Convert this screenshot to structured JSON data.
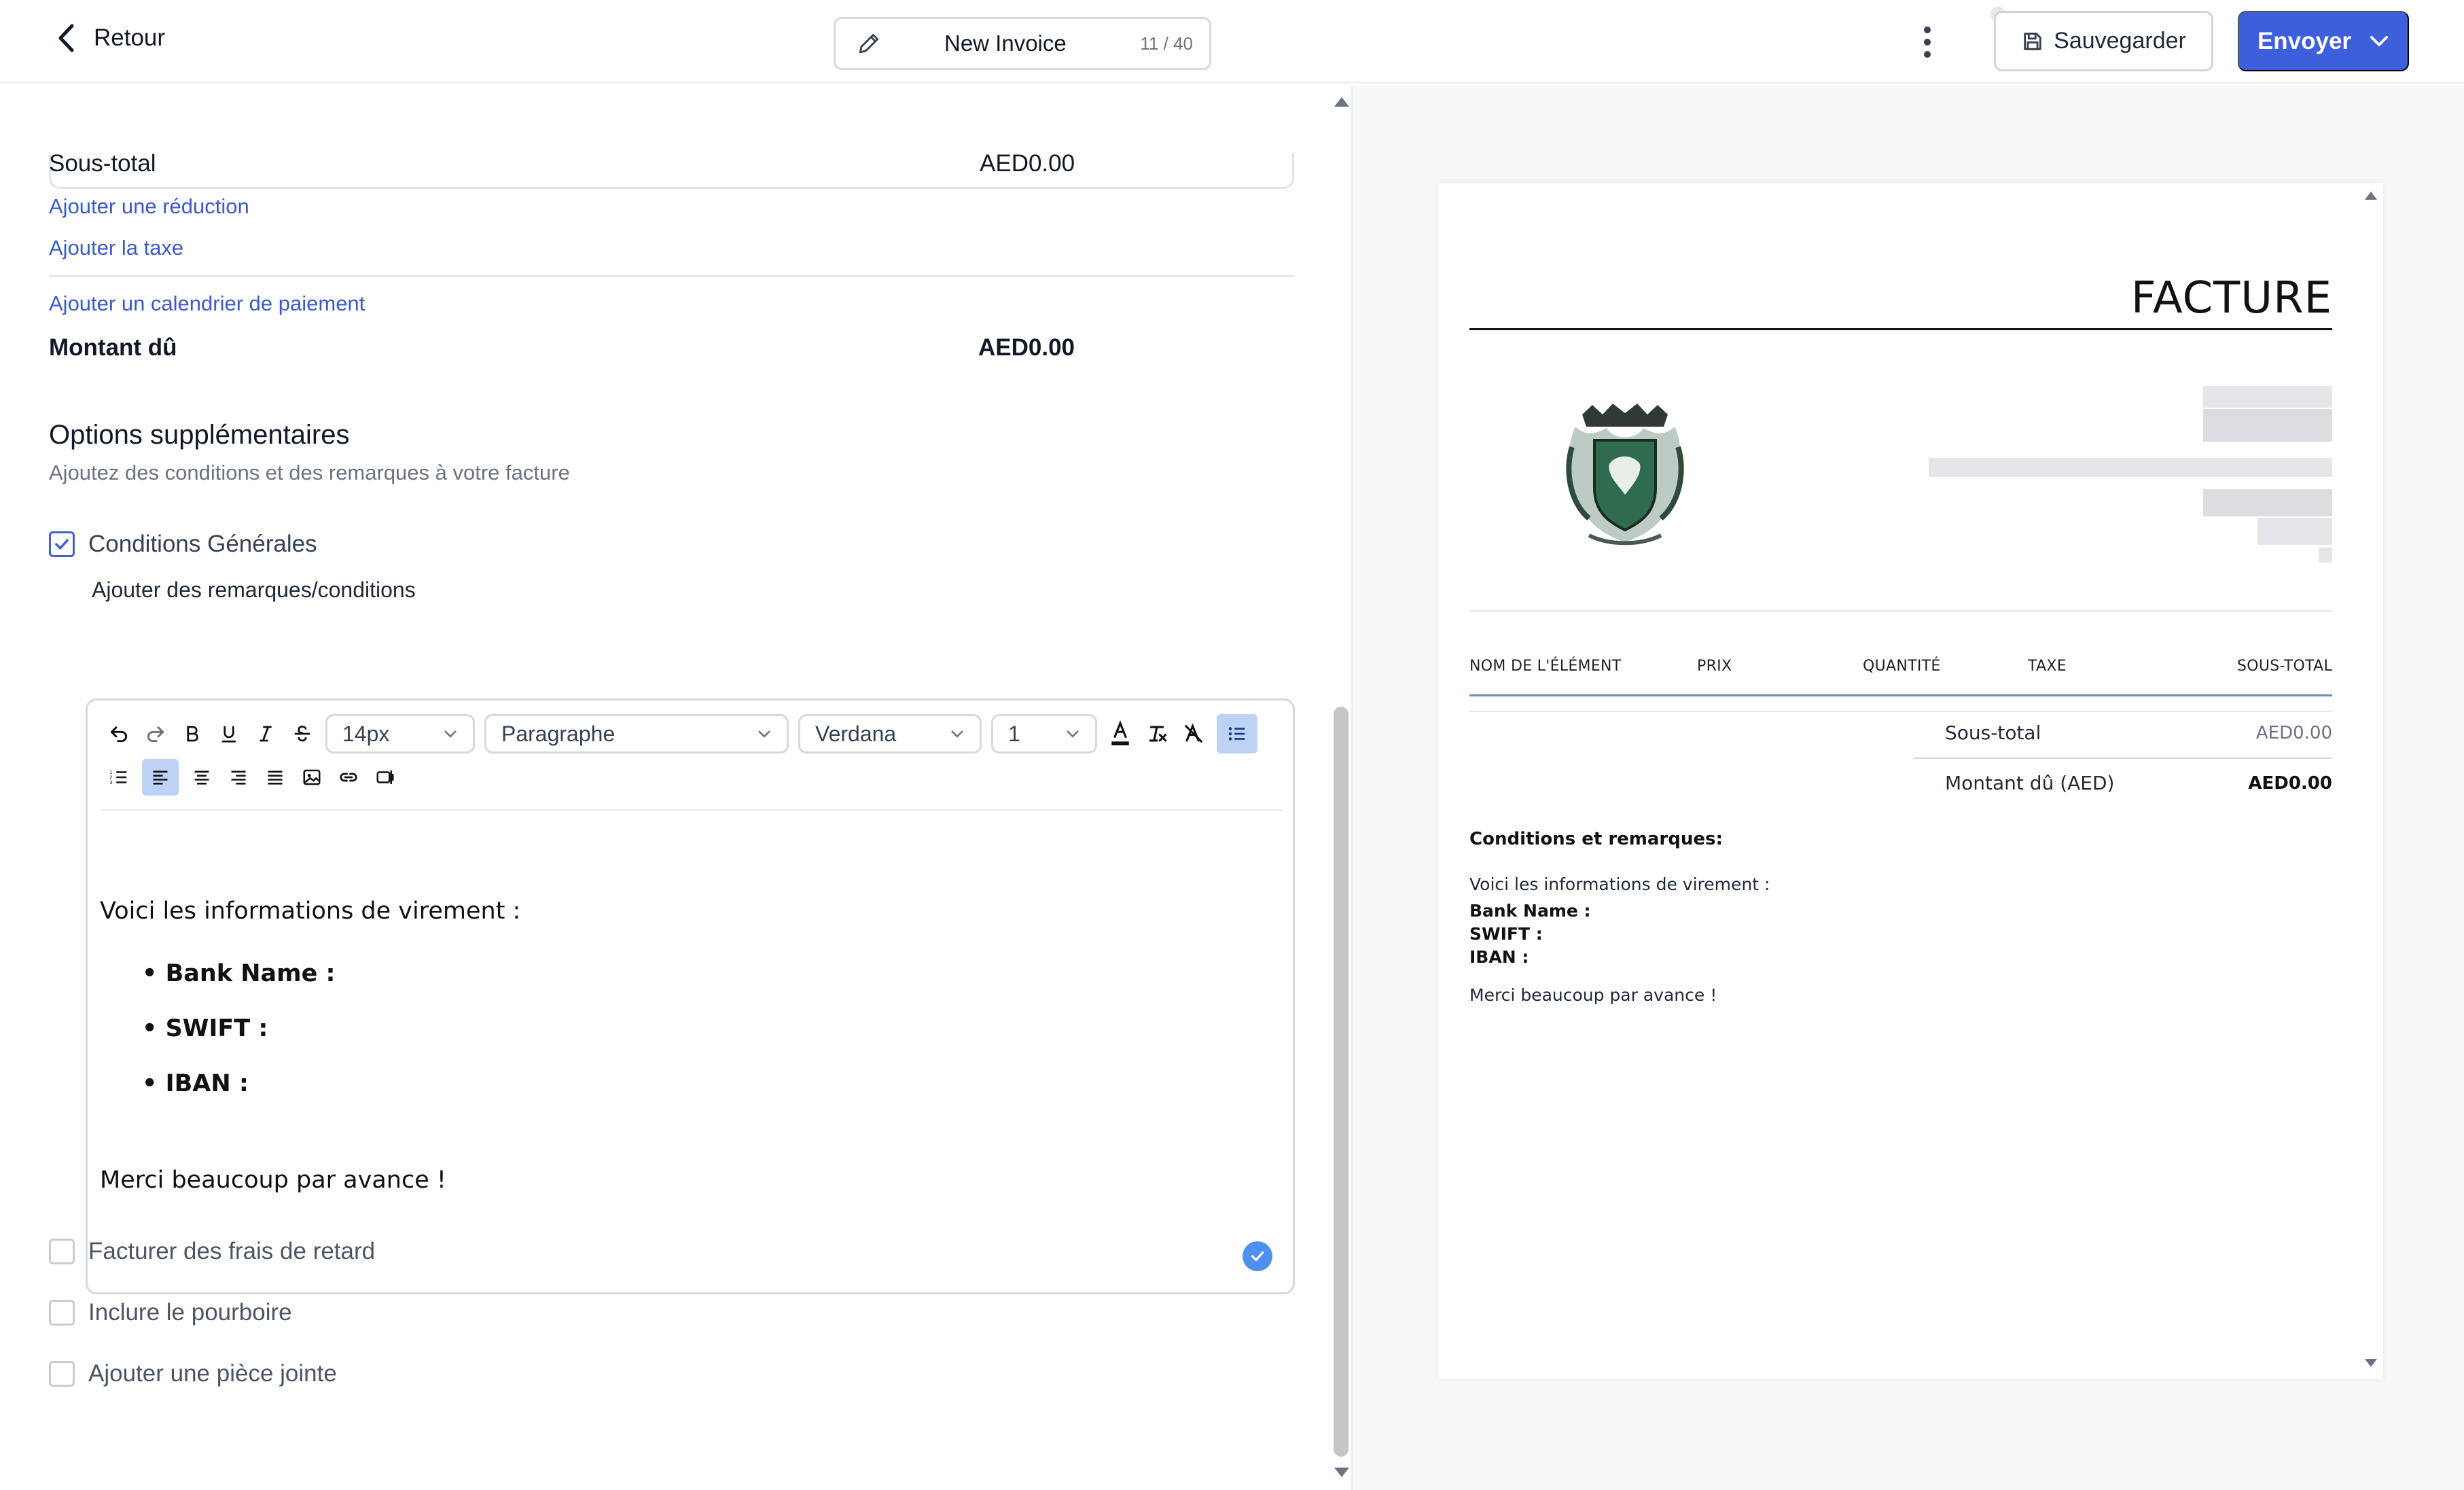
{
  "header": {
    "back_label": "Retour",
    "doc_title": "New Invoice",
    "title_counter": "11 / 40",
    "save_label": "Sauvegarder",
    "send_label": "Envoyer"
  },
  "summary": {
    "subtotal_label": "Sous-total",
    "subtotal_value": "AED0.00",
    "add_discount": "Ajouter une réduction",
    "add_tax": "Ajouter la taxe",
    "add_schedule": "Ajouter un calendrier de paiement",
    "amount_due_label": "Montant dû",
    "amount_due_value": "AED0.00"
  },
  "options": {
    "title": "Options supplémentaires",
    "subtitle": "Ajoutez des conditions et des remarques à votre facture",
    "terms_label": "Conditions Générales",
    "terms_checked": true,
    "notes_label": "Ajouter des remarques/conditions",
    "late_fee_label": "Facturer des frais de retard",
    "late_fee_checked": false,
    "tip_label": "Inclure le pourboire",
    "tip_checked": false,
    "attachment_label": "Ajouter une pièce jointe",
    "attachment_checked": false
  },
  "editor": {
    "font_size": "14px",
    "block_format": "Paragraphe",
    "font_family": "Verdana",
    "line_height": "1",
    "intro": "Voici les informations de virement :",
    "bullets": [
      "Bank Name :",
      "SWIFT :",
      "IBAN :"
    ],
    "closing": "Merci beaucoup par avance !"
  },
  "preview": {
    "title": "FACTURE",
    "columns": [
      "NOM DE L'ÉLÉMENT",
      "PRIX",
      "QUANTITÉ",
      "TAXE",
      "SOUS-TOTAL"
    ],
    "subtotal_label": "Sous-total",
    "subtotal_value": "AED0.00",
    "amount_due_label": "Montant dû (AED)",
    "amount_due_value": "AED0.00",
    "notes_heading": "Conditions et remarques:",
    "notes_intro": "Voici les informations de virement :",
    "notes_lines": [
      "Bank Name :",
      "SWIFT :",
      "IBAN :"
    ],
    "notes_closing": "Merci beaucoup par avance !"
  },
  "colors": {
    "accent": "#3e5fdb",
    "link": "#3b5bcc",
    "crest_green": "#2f6b4f"
  }
}
